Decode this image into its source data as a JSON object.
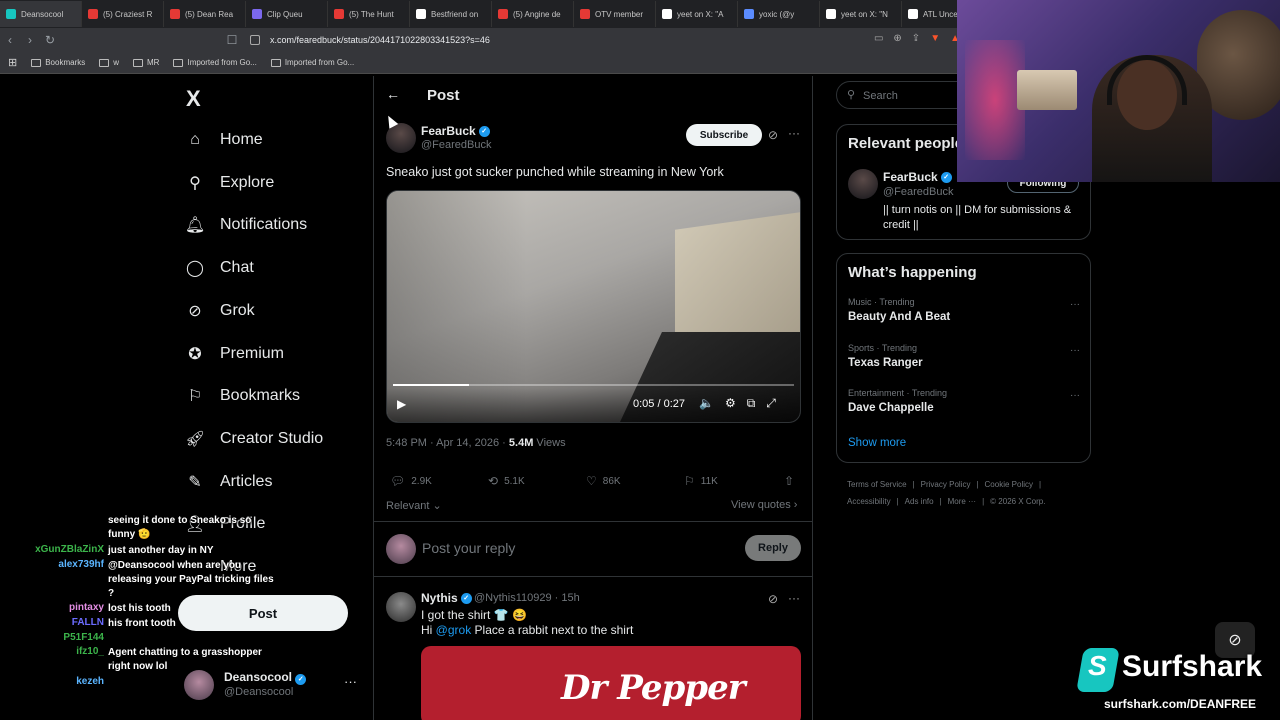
{
  "browser": {
    "tabs": [
      {
        "title": "Deansocool",
        "color": "#17c6c0"
      },
      {
        "title": "(5) Craziest R",
        "color": "#e53935"
      },
      {
        "title": "(5) Dean Rea",
        "color": "#e53935"
      },
      {
        "title": "Clip Queu",
        "color": "#7b68ee"
      },
      {
        "title": "(5) The Hunt",
        "color": "#e53935"
      },
      {
        "title": "Bestfriend on",
        "color": "#ffffff"
      },
      {
        "title": "(5) Angine de",
        "color": "#e53935"
      },
      {
        "title": "OTV member",
        "color": "#e53935"
      },
      {
        "title": "yeet on X: \"A",
        "color": "#ffffff"
      },
      {
        "title": "yoxic (@y",
        "color": "#5b8cff"
      },
      {
        "title": "yeet on X: \"N",
        "color": "#ffffff"
      },
      {
        "title": "ATL Uncen",
        "color": "#ffffff"
      }
    ],
    "url": "x.com/fearedbuck/status/2044171022803341523?s=46",
    "bookmarks": [
      {
        "label": "Bookmarks"
      },
      {
        "label": "w"
      },
      {
        "label": "MR"
      },
      {
        "label": "Imported from Go..."
      },
      {
        "label": "Imported from Go..."
      }
    ]
  },
  "nav": {
    "logo": "X",
    "items": [
      {
        "label": "Home",
        "icon": "home-icon"
      },
      {
        "label": "Explore",
        "icon": "search-icon"
      },
      {
        "label": "Notifications",
        "icon": "bell-icon"
      },
      {
        "label": "Chat",
        "icon": "chat-icon"
      },
      {
        "label": "Grok",
        "icon": "grok-icon"
      },
      {
        "label": "Premium",
        "icon": "premium-icon"
      },
      {
        "label": "Bookmarks",
        "icon": "bookmark-icon"
      },
      {
        "label": "Creator Studio",
        "icon": "rocket-icon"
      },
      {
        "label": "Articles",
        "icon": "article-icon"
      },
      {
        "label": "Profile",
        "icon": "profile-icon"
      },
      {
        "label": "More",
        "icon": "more-icon"
      }
    ],
    "post_button": "Post",
    "account": {
      "name": "Deansocool",
      "handle": "@Deansocool"
    }
  },
  "main": {
    "header_title": "Post",
    "post": {
      "author_name": "FearBuck",
      "author_handle": "@FearedBuck",
      "subscribe_label": "Subscribe",
      "text": "Sneako just got sucker punched while streaming in New York",
      "video": {
        "current_time": "0:05",
        "duration": "0:27",
        "time_display": "0:05 / 0:27",
        "progress": 0.19
      },
      "timestamp": "5:48 PM · Apr 14, 2026 · ",
      "views_count": "5.4M",
      "views_label": " Views",
      "stats": {
        "replies": "2.9K",
        "reposts": "5.1K",
        "likes": "86K",
        "bookmarks": "11K"
      }
    },
    "sort_label": "Relevant",
    "view_quotes": "View quotes",
    "reply_placeholder": "Post your reply",
    "reply_button": "Reply",
    "comment": {
      "name": "Nythis",
      "handle": "@Nythis110929 · 15h",
      "line1": "I got the shirt 👕 😆",
      "line2_prefix": "Hi ",
      "line2_mention": "@grok",
      "line2_suffix": " Place a rabbit next to the shirt",
      "image_text": "Dr Pepper"
    }
  },
  "sidebar": {
    "search_placeholder": "Search",
    "relevant_title": "Relevant people",
    "relevant_person": {
      "name": "FearBuck",
      "handle": "@FearedBuck",
      "follow_label": "Following",
      "bio": "|| turn notis on || DM for submissions & credit ||"
    },
    "happening_title": "What’s happening",
    "trends": [
      {
        "category": "Music · Trending",
        "name": "Beauty And A Beat"
      },
      {
        "category": "Sports · Trending",
        "name": "Texas Ranger"
      },
      {
        "category": "Entertainment · Trending",
        "name": "Dave Chappelle"
      }
    ],
    "show_more": "Show more",
    "footer_row1": [
      "Terms of Service",
      "|",
      "Privacy Policy",
      "|",
      "Cookie Policy",
      "|"
    ],
    "footer_row2": [
      "Accessibility",
      "|",
      "Ads info",
      "|",
      "More ···",
      "|",
      "© 2026 X Corp."
    ]
  },
  "chat": [
    {
      "user": "",
      "message": "seeing it done to Sneako is so funny 🫡",
      "color": "#ffffff"
    },
    {
      "user": "xGunZBlaZinX",
      "message": "just another day in NY",
      "color": "#3cb44b"
    },
    {
      "user": "alex739hf",
      "message": "@Deansocool when are you releasing your PayPal tricking files ?",
      "color": "#5bb5ff"
    },
    {
      "user": "pintaxy",
      "message": "lost his tooth",
      "color": "#e48ee4"
    },
    {
      "user": "FALLN",
      "message": "his front tooth",
      "color": "#6c6cff"
    },
    {
      "user": "P51F144",
      "message": "",
      "color": "#3cb44b"
    },
    {
      "user": "ifz10_",
      "message": "Agent chatting to a grasshopper right now lol",
      "color": "#3cb44b"
    },
    {
      "user": "kezeh",
      "message": "",
      "color": "#5bb5ff"
    }
  ],
  "overlay": {
    "brand": "Surfshark",
    "url": "surfshark.com/DEANFREE"
  }
}
